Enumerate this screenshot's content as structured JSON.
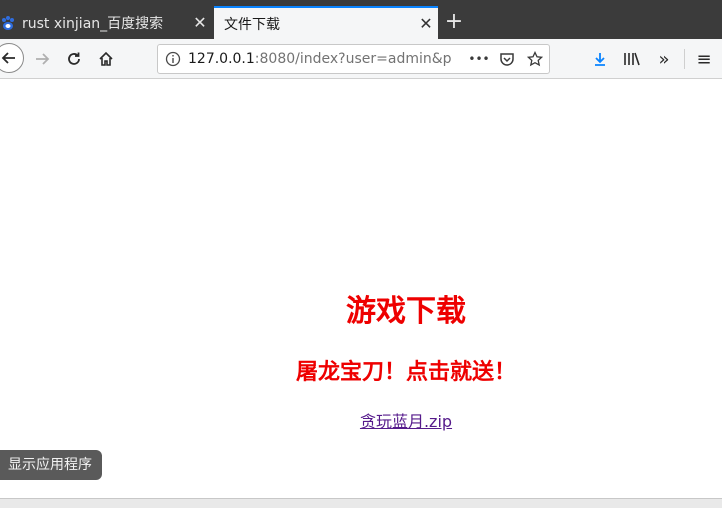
{
  "tabs": [
    {
      "title": "rust xinjian_百度搜索",
      "close": "✕"
    },
    {
      "title": "文件下载",
      "close": "✕"
    }
  ],
  "new_tab_symbol": "+",
  "nav": {
    "url_host": "127.0.0.1",
    "url_rest": ":8080/index?user=admin&p",
    "more_symbol": "•••",
    "overflow_symbol": "»",
    "menu_symbol": "≡",
    "library_symbol": "|||\\"
  },
  "page": {
    "heading": "游戏下载",
    "subheading": "屠龙宝刀！点击就送！",
    "download_link": "贪玩蓝月.zip"
  },
  "tooltip": "显示应用程序",
  "colors": {
    "accent": "#0a84ff",
    "heading_red": "#ee0000",
    "link_visited": "#551a8b",
    "download_blue": "#0a84ff"
  }
}
